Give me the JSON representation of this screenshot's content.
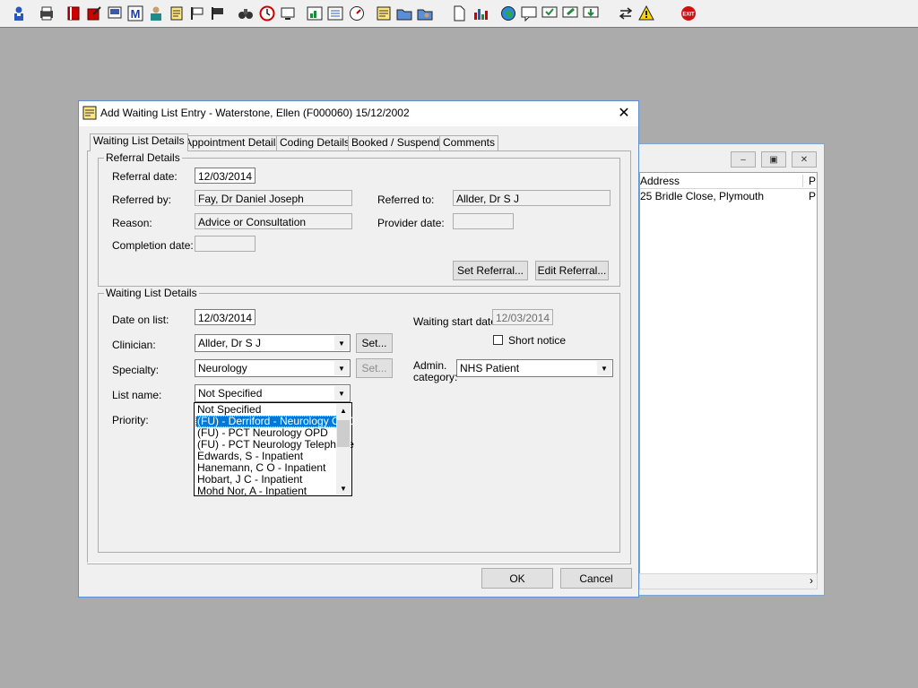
{
  "toolbar": {
    "icons": [
      "patient-search-icon",
      "print-icon",
      "book-red-icon",
      "edit-book-icon",
      "screen-icon",
      "letter-m-icon",
      "person-icon",
      "notepad-icon",
      "flag-icon",
      "flag-dark-icon",
      "binoculars-icon",
      "clock-icon",
      "monitor-icon",
      "chart-box-icon",
      "list-box-icon",
      "dial-icon",
      "note-yellow-icon",
      "folder-edit-icon",
      "folder-person-icon",
      "document-icon",
      "bar-chart-icon",
      "globe-icon",
      "message-arrow-icon",
      "message-check-icon",
      "message-green-icon",
      "message-down-icon",
      "swap-arrows-icon",
      "warning-icon",
      "exit-icon"
    ]
  },
  "background_window": {
    "columns": [
      "Address",
      "P"
    ],
    "rows": [
      [
        "25 Bridle Close, Plymouth",
        "P"
      ]
    ]
  },
  "dialog": {
    "title": "Add Waiting List Entry - Waterstone, Ellen (F000060) 15/12/2002",
    "tabs": [
      "Waiting List Details",
      "Appointment Details",
      "Coding Details",
      "Booked / Suspend",
      "Comments"
    ],
    "referral": {
      "group_title": "Referral Details",
      "referral_date_label": "Referral date:",
      "referral_date": "12/03/2014",
      "referred_by_label": "Referred by:",
      "referred_by": "Fay, Dr Daniel Joseph",
      "referred_to_label": "Referred to:",
      "referred_to": "Allder, Dr S J",
      "reason_label": "Reason:",
      "reason": "Advice or Consultation",
      "provider_date_label": "Provider date:",
      "provider_date": "",
      "completion_date_label": "Completion date:",
      "completion_date": "",
      "set_referral": "Set Referral...",
      "edit_referral": "Edit Referral..."
    },
    "waiting": {
      "group_title": "Waiting List Details",
      "date_on_list_label": "Date on list:",
      "date_on_list": "12/03/2014",
      "waiting_start_label": "Waiting start date:",
      "waiting_start": "12/03/2014",
      "clinician_label": "Clinician:",
      "clinician": "Allder, Dr S J",
      "clinician_set": "Set...",
      "short_notice_label": "Short notice",
      "specialty_label": "Specialty:",
      "specialty": "Neurology",
      "specialty_set": "Set...",
      "admin_label_1": "Admin.",
      "admin_label_2": "category:",
      "admin_category": "NHS Patient",
      "list_name_label": "List name:",
      "list_name": "Not Specified",
      "priority_label": "Priority:",
      "list_options": [
        "Not Specified",
        "(FU) - Derriford - Neurology OPD",
        "(FU) - PCT Neurology  OPD",
        "(FU) - PCT Neurology Telephone",
        "Edwards, S - Inpatient",
        "Hanemann, C O - Inpatient",
        "Hobart, J C - Inpatient",
        "Mohd Nor, A - Inpatient"
      ],
      "selected_option": "(FU) - Derriford - Neurology OPD"
    },
    "ok": "OK",
    "cancel": "Cancel"
  }
}
